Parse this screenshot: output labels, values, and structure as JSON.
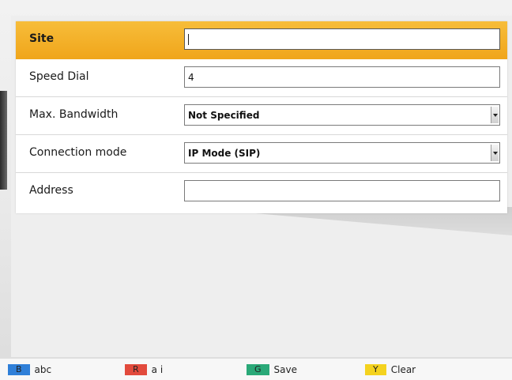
{
  "form": {
    "rows": [
      {
        "label": "Site",
        "value": "",
        "type": "text",
        "active": true
      },
      {
        "label": "Speed Dial",
        "value": "4",
        "type": "text"
      },
      {
        "label": "Max. Bandwidth",
        "value": "Not Specified",
        "type": "select"
      },
      {
        "label": "Connection mode",
        "value": "IP Mode (SIP)",
        "type": "select"
      },
      {
        "label": "Address",
        "value": "",
        "type": "text"
      }
    ]
  },
  "footer": {
    "keys": [
      {
        "cap": "B",
        "label": "abc",
        "color": "#2f7fd8"
      },
      {
        "cap": "R",
        "label": "a i",
        "color": "#e24a3c"
      },
      {
        "cap": "G",
        "label": "Save",
        "color": "#2aa978"
      },
      {
        "cap": "Y",
        "label": "Clear",
        "color": "#f4d21e"
      }
    ]
  },
  "colors": {
    "active_row": "#f0a51a"
  }
}
